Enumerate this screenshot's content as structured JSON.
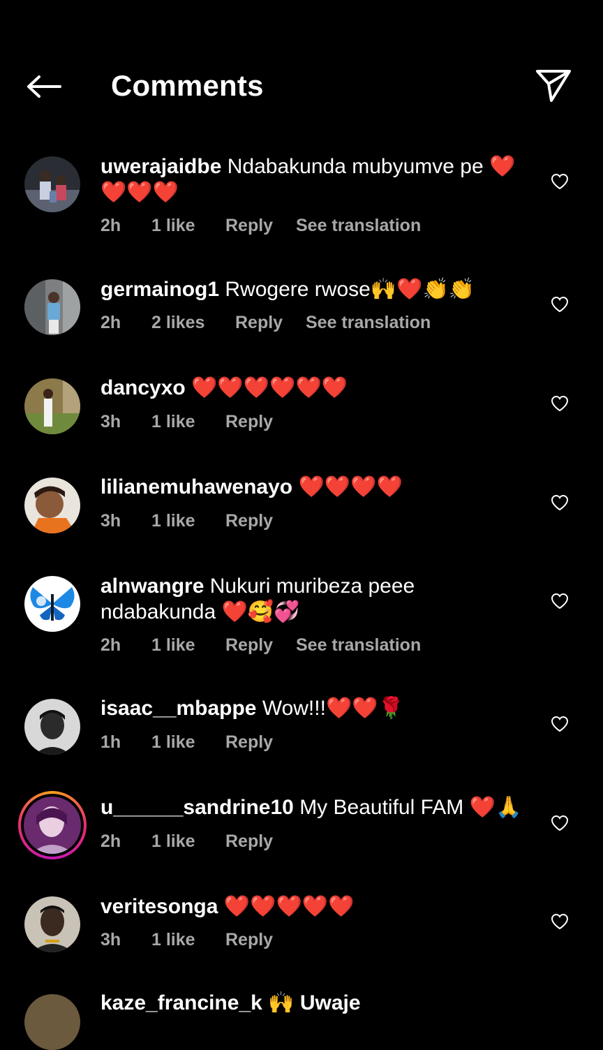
{
  "header": {
    "title": "Comments",
    "back_icon": "arrow-left-icon",
    "share_icon": "paper-plane-icon"
  },
  "colors": {
    "background": "#000000",
    "text": "#ffffff",
    "meta": "#a8a8a8",
    "story_ring": "#e52e71"
  },
  "comments": [
    {
      "username": "uwerajaidbe",
      "text": "Ndabakunda mubyumve pe ❤️❤️❤️❤️",
      "time": "2h",
      "likes": "1 like",
      "reply": "Reply",
      "translate": "See translation"
    },
    {
      "username": "germainog1",
      "text": "Rwogere rwose🙌❤️👏👏",
      "time": "2h",
      "likes": "2 likes",
      "reply": "Reply",
      "translate": "See translation"
    },
    {
      "username": "dancyxo",
      "text": "❤️❤️❤️❤️❤️❤️",
      "time": "3h",
      "likes": "1 like",
      "reply": "Reply"
    },
    {
      "username": "lilianemuhawenayo",
      "text": "❤️❤️❤️❤️",
      "time": "3h",
      "likes": "1 like",
      "reply": "Reply"
    },
    {
      "username": "alnwangre",
      "text": "Nukuri muribeza peee ndabakunda ❤️🥰💞",
      "time": "2h",
      "likes": "1 like",
      "reply": "Reply",
      "translate": "See translation"
    },
    {
      "username": "isaac__mbappe",
      "text": "Wow!!!❤️❤️🌹",
      "time": "1h",
      "likes": "1 like",
      "reply": "Reply"
    },
    {
      "username": "u______sandrine10",
      "text": "My Beautiful FAM ❤️🙏",
      "time": "2h",
      "likes": "1 like",
      "reply": "Reply"
    },
    {
      "username": "veritesonga",
      "text": "❤️❤️❤️❤️❤️",
      "time": "3h",
      "likes": "1 like",
      "reply": "Reply"
    }
  ],
  "partial_comment": {
    "text": "kaze_francine_k 🙌 Uwaje"
  }
}
